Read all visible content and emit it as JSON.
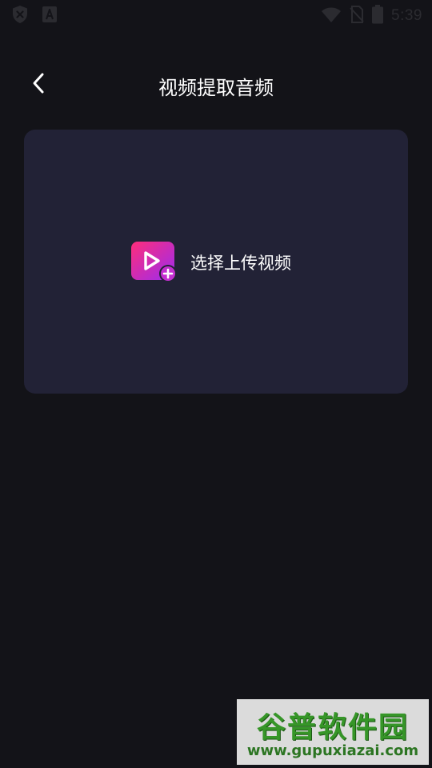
{
  "status_bar": {
    "time": "5:39",
    "icons": [
      "shield-x-icon",
      "font-a-icon",
      "wifi-icon",
      "no-sim-icon",
      "battery-icon"
    ]
  },
  "header": {
    "back_icon": "chevron-left-icon",
    "title": "视频提取音频"
  },
  "upload": {
    "icon": "video-add-icon",
    "label": "选择上传视频"
  },
  "watermark": {
    "brand": "谷普软件园",
    "url": "www.gupuxiazai.com"
  },
  "colors": {
    "background": "#131318",
    "card": "#222236",
    "icon_gradient_start": "#ff2d7a",
    "icon_gradient_end": "#9b2cf0",
    "status_icon": "#2b2b30"
  }
}
